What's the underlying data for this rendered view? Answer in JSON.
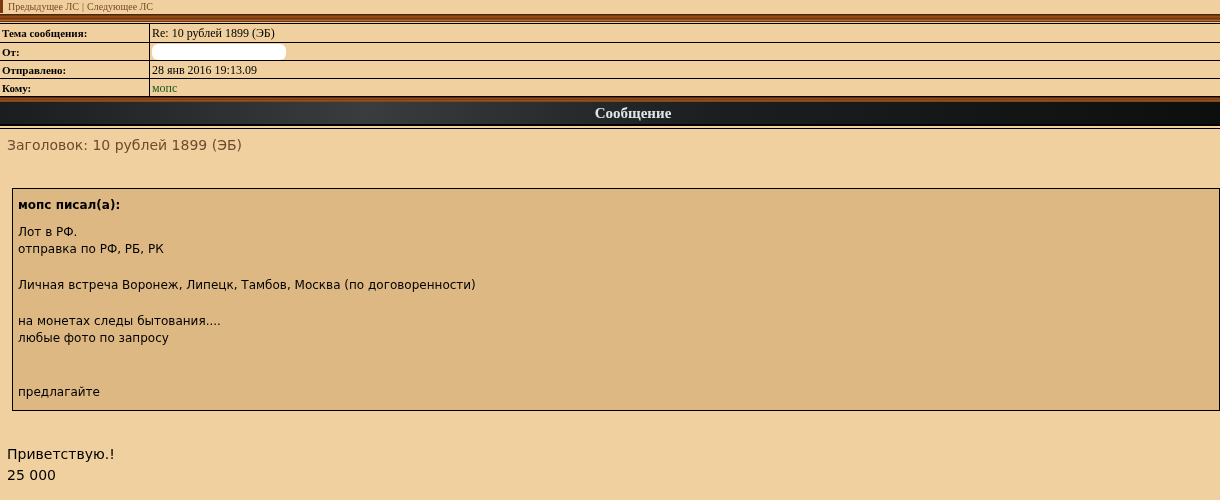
{
  "nav": {
    "links": [
      "Предыдущее ЛС",
      "Следующее ЛС"
    ],
    "separator": "|"
  },
  "header_rows": [
    {
      "label": "Тема сообщения:",
      "value": "Re: 10 рублей 1899 (ЭБ)",
      "kind": "text"
    },
    {
      "label": "От:",
      "kind": "redacted"
    },
    {
      "label": "Отправлено:",
      "value": "28 янв 2016 19:13.09",
      "kind": "text"
    },
    {
      "label": "Кому:",
      "value": "мопс",
      "kind": "link"
    }
  ],
  "section_title": "Сообщение",
  "subject": "Заголовок: 10 рублей 1899 (ЭБ)",
  "quote": {
    "author": "мопс писал(а):",
    "paragraphs": [
      {
        "kind": "first",
        "lines": [
          "Лот в РФ.",
          "отправка по РФ, РБ, РК"
        ]
      },
      {
        "kind": "normal",
        "lines": [
          "Личная встреча Воронеж, Липецк, Тамбов, Москва (по договоренности)"
        ]
      },
      {
        "kind": "normal",
        "lines": [
          "на монетах следы бытования....",
          "любые фото по запросу"
        ]
      },
      {
        "kind": "spaced",
        "lines": [
          "предлагайте"
        ]
      }
    ]
  },
  "body": [
    "Приветствую.!",
    "25 000"
  ]
}
